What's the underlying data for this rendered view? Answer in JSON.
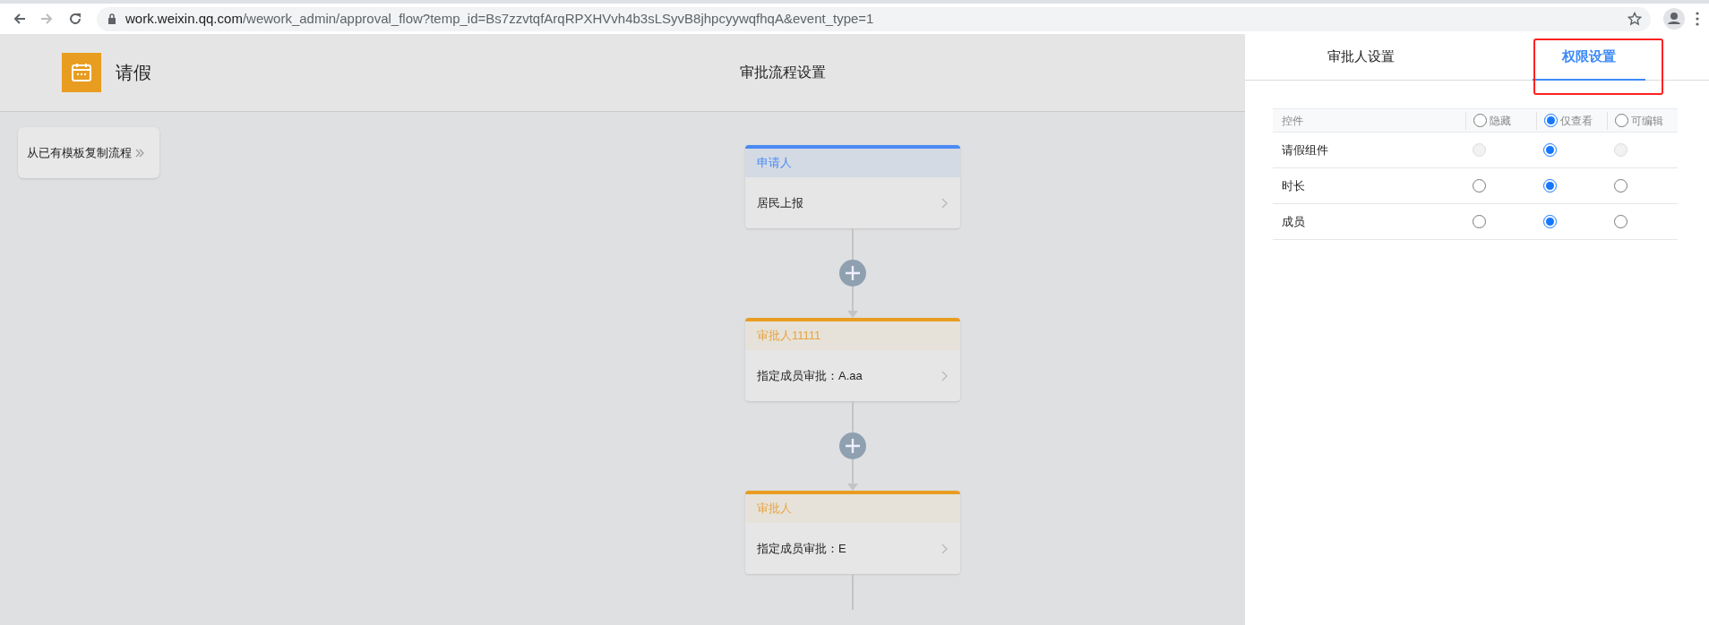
{
  "browser": {
    "url_host": "work.weixin.qq.com",
    "url_path": "/wework_admin/approval_flow?temp_id=Bs7zzvtqfArqRPXHVvh4b3sLSyvB8jhpcyywqfhqA&event_type=1"
  },
  "header": {
    "app_name": "请假",
    "page_title": "审批流程设置"
  },
  "copy_button": {
    "label": "从已有模板复制流程"
  },
  "flow": {
    "nodes": [
      {
        "kind": "applicant",
        "title": "申请人",
        "detail": "居民上报"
      },
      {
        "kind": "approver",
        "title": "审批人11111",
        "detail": "指定成员审批：A.aa"
      },
      {
        "kind": "approver",
        "title": "审批人",
        "detail": "指定成员审批：E"
      }
    ]
  },
  "tabs": [
    {
      "label": "审批人设置",
      "selected": false
    },
    {
      "label": "权限设置",
      "selected": true
    }
  ],
  "permissions": {
    "column_header": "控件",
    "options": [
      {
        "label": "隐藏",
        "selected": false
      },
      {
        "label": "仅查看",
        "selected": true
      },
      {
        "label": "可编辑",
        "selected": false
      }
    ],
    "rows": [
      {
        "label": "请假组件",
        "options": [
          {
            "selected": false,
            "disabled": true
          },
          {
            "selected": true,
            "disabled": false
          },
          {
            "selected": false,
            "disabled": true
          }
        ]
      },
      {
        "label": "时长",
        "options": [
          {
            "selected": false,
            "disabled": false
          },
          {
            "selected": true,
            "disabled": false
          },
          {
            "selected": false,
            "disabled": false
          }
        ]
      },
      {
        "label": "成员",
        "options": [
          {
            "selected": false,
            "disabled": false
          },
          {
            "selected": true,
            "disabled": false
          },
          {
            "selected": false,
            "disabled": false
          }
        ]
      }
    ]
  }
}
